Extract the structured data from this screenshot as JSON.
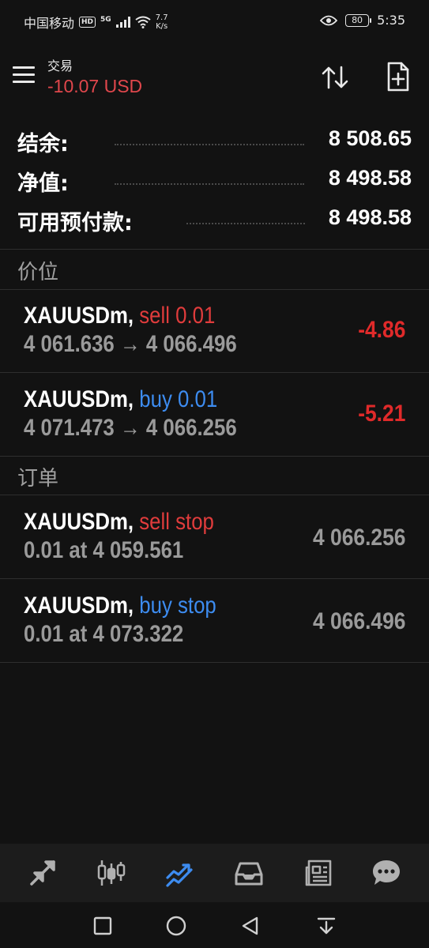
{
  "status_bar": {
    "carrier": "中国移动",
    "hd_badge": "HD",
    "network": "5G",
    "speed_value": "7.7",
    "speed_unit": "K/s",
    "battery": "80",
    "time": "5:35"
  },
  "header": {
    "title": "交易",
    "subtitle": "-10.07 USD"
  },
  "summary": {
    "rows": [
      {
        "label": "结余:",
        "value": "8 508.65"
      },
      {
        "label": "净值:",
        "value": "8 498.58"
      },
      {
        "label": "可用预付款:",
        "value": "8 498.58"
      }
    ]
  },
  "positions": {
    "heading": "价位",
    "items": [
      {
        "symbol": "XAUUSDm,",
        "side": "sell 0.01",
        "prices": "4 061.636 → 4 066.496",
        "profit": "-4.86"
      },
      {
        "symbol": "XAUUSDm,",
        "side": "buy 0.01",
        "prices": "4 071.473 → 4 066.256",
        "profit": "-5.21"
      }
    ]
  },
  "orders": {
    "heading": "订单",
    "items": [
      {
        "symbol": "XAUUSDm,",
        "side": "sell stop",
        "details": "0.01 at 4 059.561",
        "current": "4 066.256"
      },
      {
        "symbol": "XAUUSDm,",
        "side": "buy stop",
        "details": "0.01 at 4 073.322",
        "current": "4 066.496"
      }
    ]
  },
  "tabs": [
    {
      "icon": "quotes-arrows-icon",
      "active": false
    },
    {
      "icon": "candlestick-chart-icon",
      "active": false
    },
    {
      "icon": "trade-chart-icon",
      "active": true
    },
    {
      "icon": "inbox-tray-icon",
      "active": false
    },
    {
      "icon": "news-icon",
      "active": false
    },
    {
      "icon": "chat-bubble-icon",
      "active": false
    }
  ],
  "colors": {
    "background": "#121212",
    "sell": "#e03c3c",
    "buy": "#3d8cf0",
    "loss": "#e02a2a",
    "active_tab": "#3d8cf0",
    "muted_text": "#9a9a9a"
  }
}
